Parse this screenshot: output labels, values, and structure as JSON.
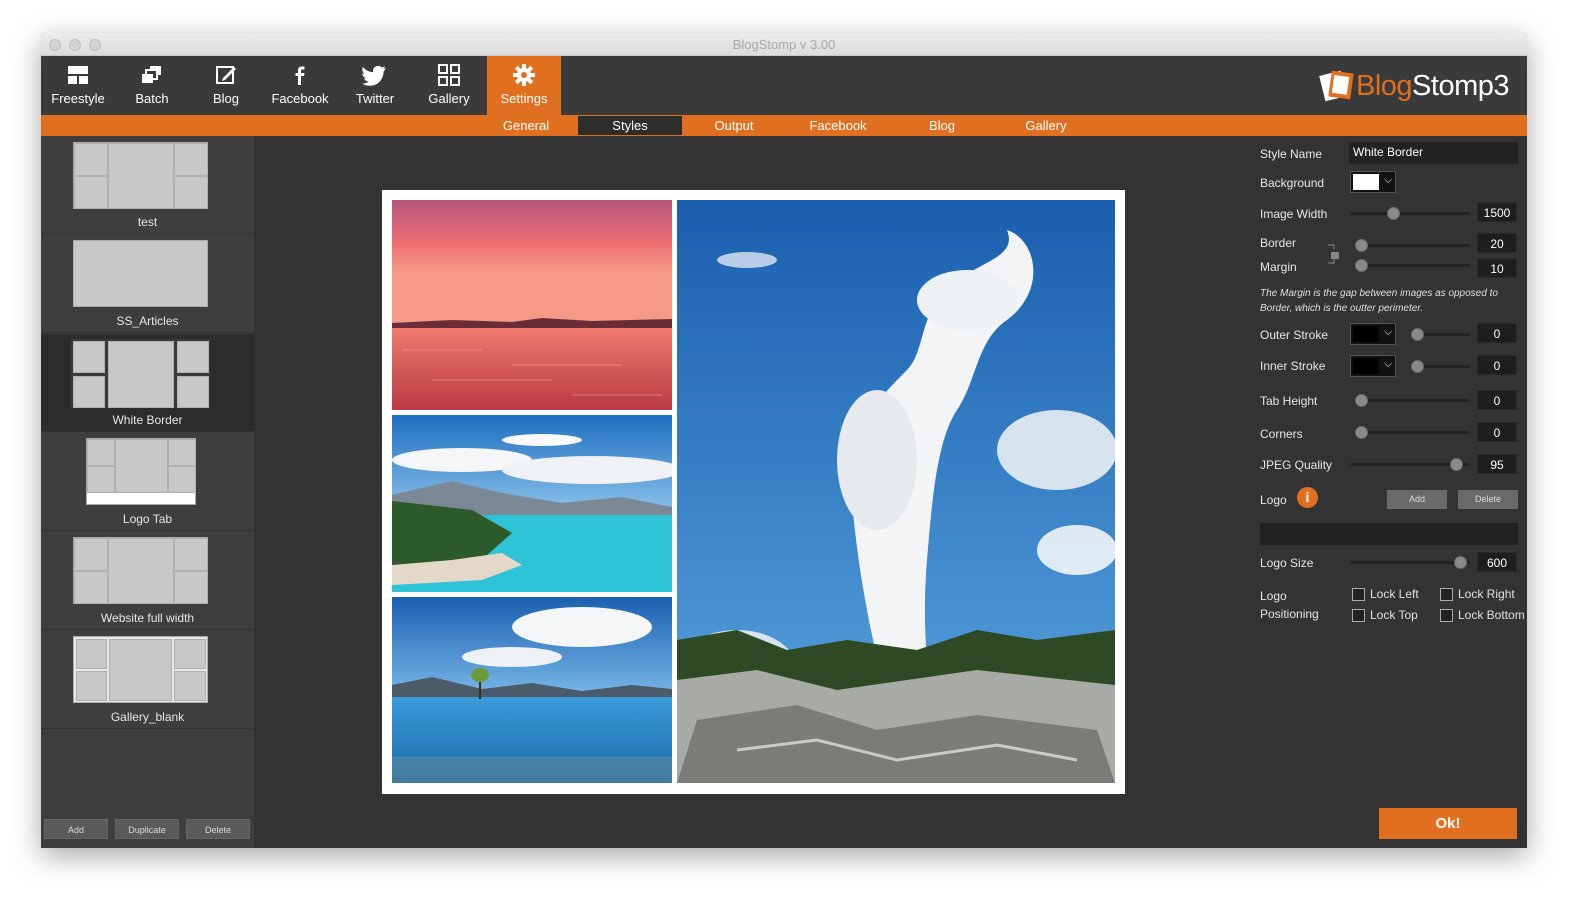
{
  "window": {
    "title": "BlogStomp v 3.00"
  },
  "toolbar": {
    "items": [
      {
        "label": "Freestyle",
        "icon": "freestyle-icon"
      },
      {
        "label": "Batch",
        "icon": "batch-icon"
      },
      {
        "label": "Blog",
        "icon": "blog-edit-icon"
      },
      {
        "label": "Facebook",
        "icon": "facebook-icon"
      },
      {
        "label": "Twitter",
        "icon": "twitter-icon"
      },
      {
        "label": "Gallery",
        "icon": "gallery-grid-icon"
      },
      {
        "label": "Settings",
        "icon": "gear-icon",
        "active": true
      }
    ],
    "logo_part1": "Blog",
    "logo_part2": "Stomp3"
  },
  "subnav": {
    "tabs": [
      "General",
      "Styles",
      "Output",
      "Facebook",
      "Blog",
      "Gallery"
    ],
    "active": "Styles"
  },
  "sidebar": {
    "styles": [
      "test",
      "SS_Articles",
      "White Border",
      "Logo Tab",
      "Website full width",
      "Gallery_blank"
    ],
    "active": "White Border",
    "buttons": {
      "add": "Add",
      "duplicate": "Duplicate",
      "delete": "Delete"
    }
  },
  "panel": {
    "style_name_label": "Style Name",
    "style_name_value": "White Border",
    "background_label": "Background",
    "background_color": "#ffffff",
    "image_width_label": "Image Width",
    "image_width_value": "1500",
    "border_label": "Border",
    "border_value": "20",
    "margin_label": "Margin",
    "margin_value": "10",
    "note": "The Margin is the gap between images as opposed to Border, which is the outter perimeter.",
    "outer_stroke_label": "Outer Stroke",
    "outer_stroke_value": "0",
    "inner_stroke_label": "Inner Stroke",
    "inner_stroke_value": "0",
    "tab_height_label": "Tab Height",
    "tab_height_value": "0",
    "corners_label": "Corners",
    "corners_value": "0",
    "jpeg_quality_label": "JPEG Quality",
    "jpeg_quality_value": "95",
    "logo_label": "Logo",
    "logo_add": "Add",
    "logo_delete": "Delete",
    "logo_size_label": "Logo Size",
    "logo_size_value": "600",
    "logo_positioning_label1": "Logo",
    "logo_positioning_label2": "Positioning",
    "lock_left": "Lock Left",
    "lock_right": "Lock Right",
    "lock_top": "Lock Top",
    "lock_bottom": "Lock Bottom",
    "ok": "Ok!"
  },
  "colors": {
    "accent": "#e07020",
    "toolbar": "#3a3a3a",
    "panel": "#333333"
  }
}
